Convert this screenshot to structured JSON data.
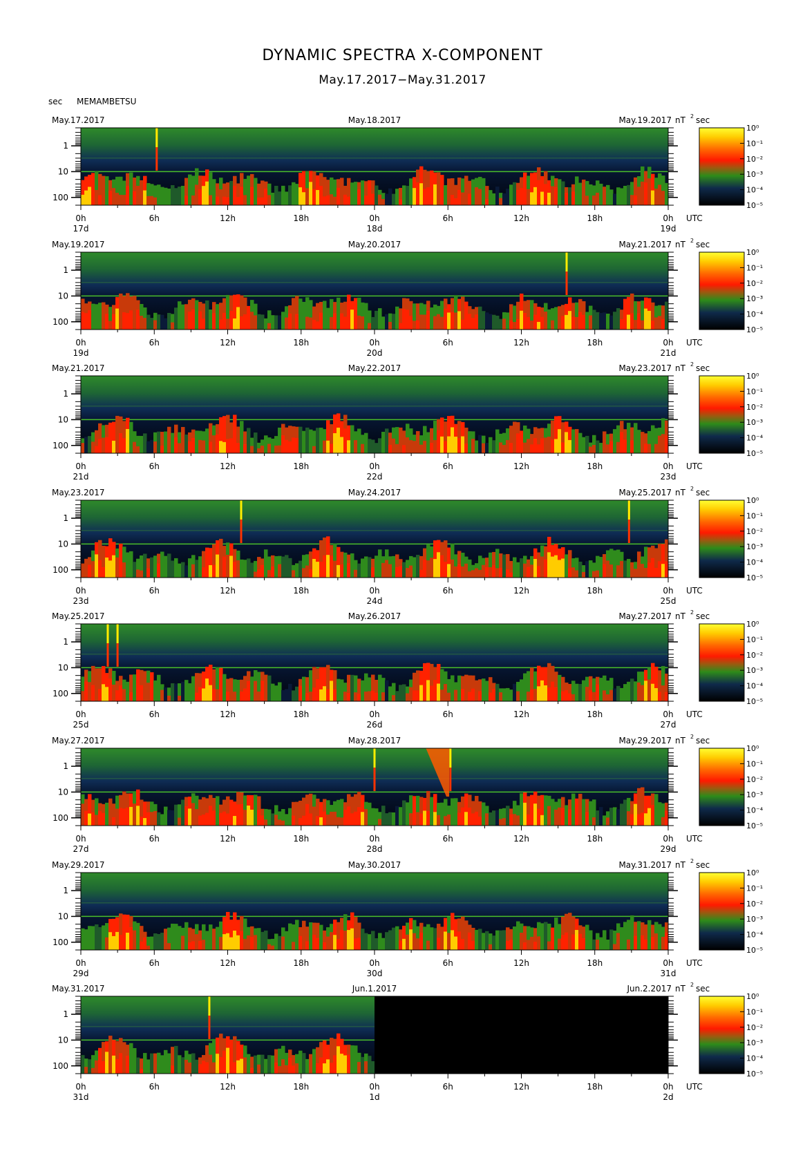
{
  "title": "DYNAMIC SPECTRA X-COMPONENT",
  "subtitle": "May.17.2017−May.31.2017",
  "y_unit": "sec",
  "station": "MEMAMBETSU",
  "cbar_unit": "nT",
  "cbar_unit_exp": "2",
  "cbar_unit_suffix": "sec",
  "tz_label": "UTC",
  "chart_data": {
    "type": "heatmap",
    "title": "DYNAMIC SPECTRA X-COMPONENT",
    "subtitle": "May.17.2017−May.31.2017",
    "ylabel": "sec",
    "yscale": "log",
    "y_ticks": [
      "1",
      "10",
      "100"
    ],
    "x_ticks": [
      "0h",
      "6h",
      "12h",
      "18h",
      "0h",
      "6h",
      "12h",
      "18h",
      "0h"
    ],
    "colorbar": {
      "unit": "nT² sec",
      "ticks": [
        "10⁰",
        "10⁻¹",
        "10⁻²",
        "10⁻³",
        "10⁻⁴",
        "10⁻⁵"
      ],
      "colors": [
        "#ffff33",
        "#ff9900",
        "#ff1a00",
        "#2e8b1a",
        "#0f2a4a",
        "#000000"
      ]
    },
    "panels": [
      {
        "dates": [
          "May.17.2017",
          "May.18.2017",
          "May.19.2017"
        ],
        "days": [
          "17d",
          "18d",
          "19d"
        ],
        "spikes_h": [
          6.2
        ],
        "bursts": [],
        "noData": false
      },
      {
        "dates": [
          "May.19.2017",
          "May.20.2017",
          "May.21.2017"
        ],
        "days": [
          "19d",
          "20d",
          "21d"
        ],
        "spikes_h": [
          39.7
        ],
        "bursts": [],
        "noData": false
      },
      {
        "dates": [
          "May.21.2017",
          "May.22.2017",
          "May.23.2017"
        ],
        "days": [
          "21d",
          "22d",
          "23d"
        ],
        "spikes_h": [],
        "bursts": [],
        "noData": false
      },
      {
        "dates": [
          "May.23.2017",
          "May.24.2017",
          "May.25.2017"
        ],
        "days": [
          "23d",
          "24d",
          "25d"
        ],
        "spikes_h": [
          13.1,
          44.8
        ],
        "bursts": [],
        "noData": false
      },
      {
        "dates": [
          "May.25.2017",
          "May.26.2017",
          "May.27.2017"
        ],
        "days": [
          "25d",
          "26d",
          "27d"
        ],
        "spikes_h": [
          2.2,
          3.0
        ],
        "bursts": [],
        "noData": false
      },
      {
        "dates": [
          "May.27.2017",
          "May.28.2017",
          "May.29.2017"
        ],
        "days": [
          "27d",
          "28d",
          "29d"
        ],
        "spikes_h": [
          24.0,
          30.2
        ],
        "bursts": [
          [
            28.2,
            30.1
          ]
        ],
        "noData": false
      },
      {
        "dates": [
          "May.29.2017",
          "May.30.2017",
          "May.31.2017"
        ],
        "days": [
          "29d",
          "30d",
          "31d"
        ],
        "spikes_h": [],
        "bursts": [],
        "noData": false
      },
      {
        "dates": [
          "May.31.2017",
          "Jun.1.2017",
          "Jun.2.2017"
        ],
        "days": [
          "31d",
          "1d",
          "2d"
        ],
        "spikes_h": [
          10.5
        ],
        "bursts": [],
        "noData": true
      }
    ]
  }
}
